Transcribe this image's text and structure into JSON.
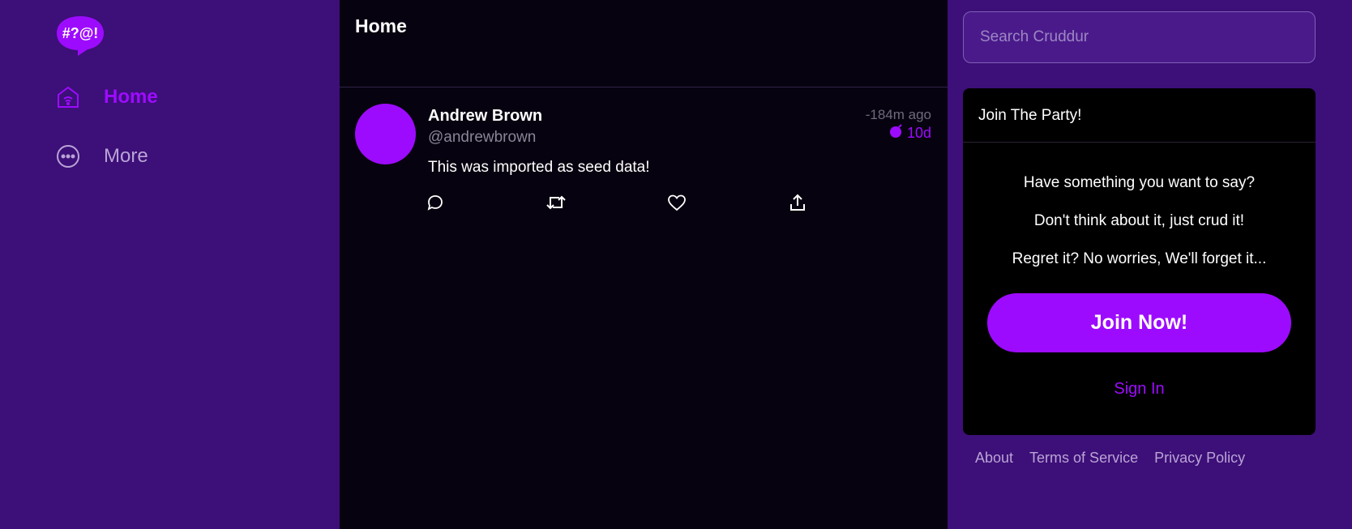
{
  "app": {
    "logo_text": "#?@!"
  },
  "nav": {
    "home_label": "Home",
    "more_label": "More"
  },
  "feed": {
    "title": "Home",
    "cruds": [
      {
        "display_name": "Andrew Brown",
        "handle": "@andrewbrown",
        "created": "-184m ago",
        "expires": "10d",
        "message": "This was imported as seed data!"
      }
    ]
  },
  "search": {
    "placeholder": "Search Cruddur"
  },
  "join": {
    "title": "Join The Party!",
    "line1": "Have something you want to say?",
    "line2": "Don't think about it, just crud it!",
    "line3": "Regret it? No worries, We'll forget it...",
    "button": "Join Now!",
    "signin": "Sign In"
  },
  "footer": {
    "about": "About",
    "terms": "Terms of Service",
    "privacy": "Privacy Policy"
  },
  "colors": {
    "accent": "#9d0bff",
    "sidebar_bg": "#3d0f78",
    "feed_bg": "#07020f"
  },
  "icons": [
    "home-icon",
    "more-icon",
    "reply-icon",
    "repost-icon",
    "like-icon",
    "share-icon",
    "bomb-icon"
  ]
}
